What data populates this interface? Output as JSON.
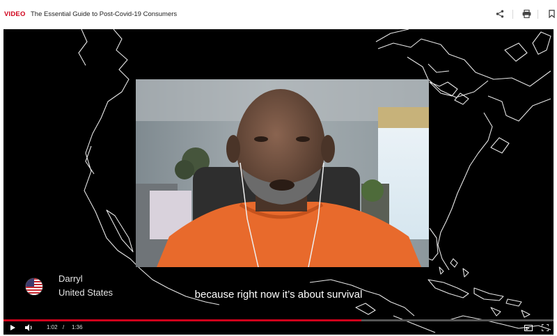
{
  "header": {
    "tag": "VIDEO",
    "title": "The Essential Guide to Post-Covid-19 Consumers",
    "icons": [
      "share-icon",
      "print-icon",
      "bookmark-icon"
    ]
  },
  "video": {
    "speaker": {
      "name": "Darryl",
      "country": "United States",
      "flag": "us-flag-icon"
    },
    "caption": "because right now it’s about survival",
    "current_time": "1:02",
    "time_separator": "/",
    "duration": "1:36",
    "progress_fraction": 0.65,
    "controls": [
      "play-icon",
      "volume-icon",
      "captions-icon",
      "fullscreen-icon"
    ]
  },
  "colors": {
    "accent": "#d0021b",
    "player_bg": "#000000",
    "shirt": "#e86a2c"
  }
}
